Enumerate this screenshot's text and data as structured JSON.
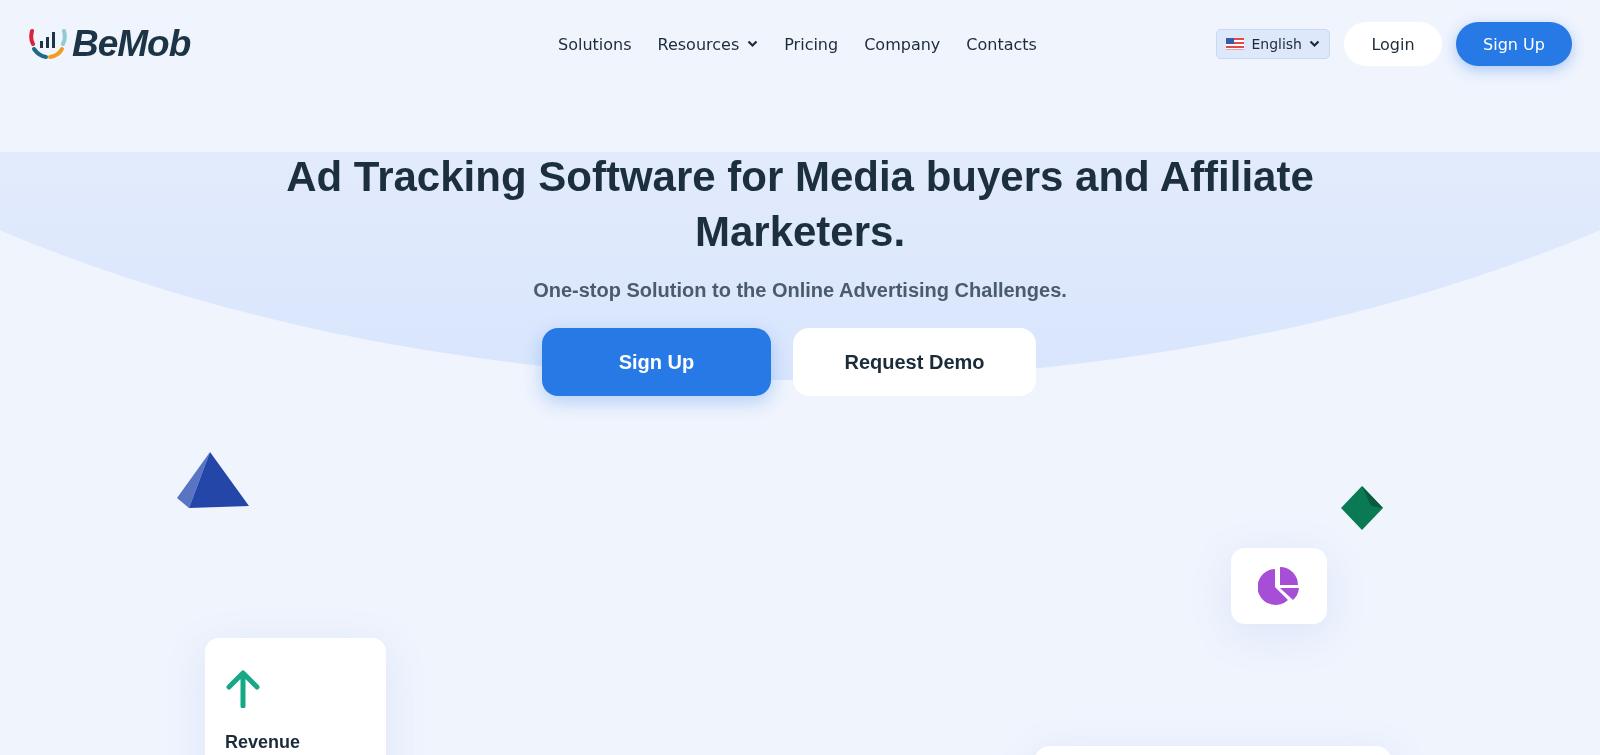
{
  "header": {
    "logo": "BeMob",
    "nav": [
      {
        "label": "Solutions",
        "dropdown": false
      },
      {
        "label": "Resources",
        "dropdown": true
      },
      {
        "label": "Pricing",
        "dropdown": false
      },
      {
        "label": "Company",
        "dropdown": false
      },
      {
        "label": "Contacts",
        "dropdown": false
      }
    ],
    "language": {
      "label": "English"
    },
    "login": "Login",
    "signup": "Sign Up"
  },
  "hero": {
    "title": "Ad Tracking Software for Media buyers and Affiliate Marketers.",
    "subtitle": "One-stop Solution to the Online Advertising Challenges.",
    "buttons": [
      {
        "label": "Sign Up",
        "kind": "primary"
      },
      {
        "label": "Request Demo",
        "kind": "secondary"
      }
    ]
  },
  "cards": [
    {
      "label": "Revenue"
    }
  ]
}
